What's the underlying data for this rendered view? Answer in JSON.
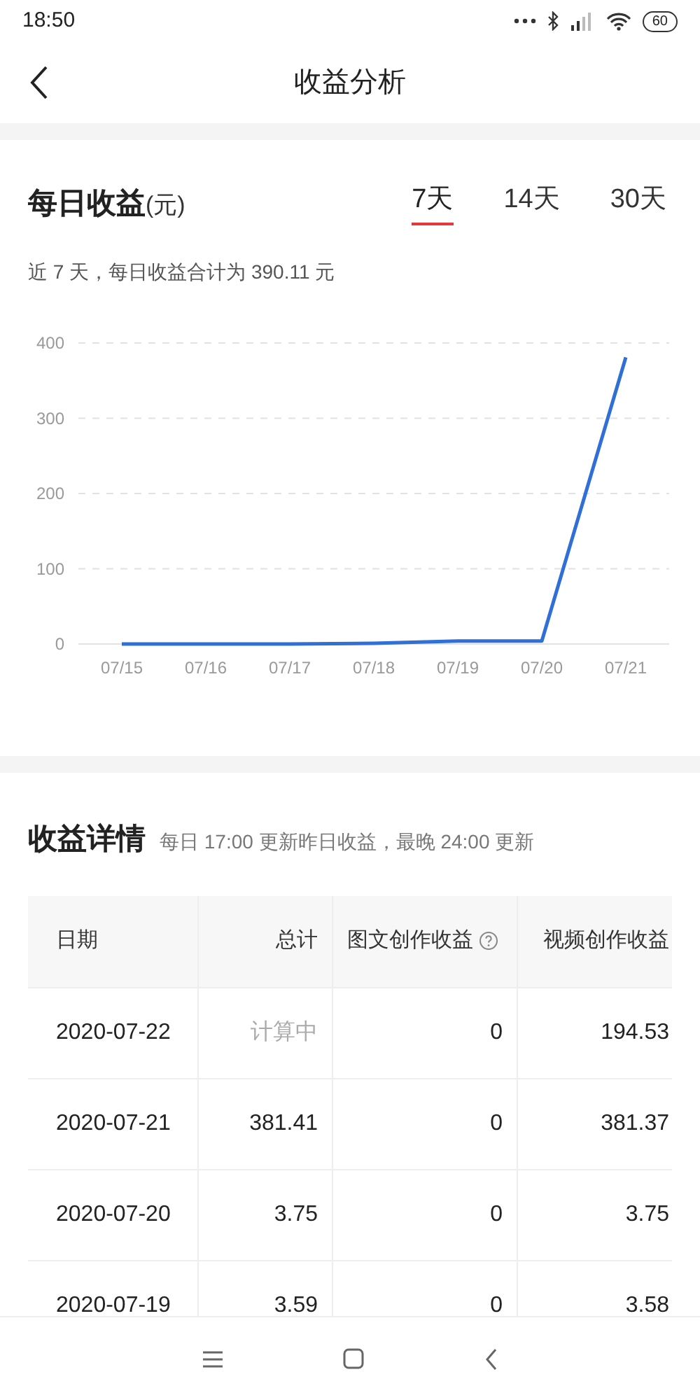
{
  "status_bar": {
    "time": "18:50",
    "battery": "60"
  },
  "header": {
    "title": "收益分析"
  },
  "daily": {
    "title": "每日收益",
    "unit": "(元)",
    "tabs": [
      {
        "label": "7天",
        "selected": true
      },
      {
        "label": "14天",
        "selected": false
      },
      {
        "label": "30天",
        "selected": false
      }
    ],
    "summary": "近 7 天，每日收益合计为 390.11 元",
    "chart_data": {
      "type": "line",
      "categories": [
        "07/15",
        "07/16",
        "07/17",
        "07/18",
        "07/19",
        "07/20",
        "07/21"
      ],
      "series": [
        {
          "color": "#2f6fd6",
          "values": [
            0,
            0,
            0,
            1,
            4,
            4,
            381
          ]
        }
      ],
      "ylim": [
        0,
        400
      ],
      "yticks": [
        0,
        100,
        200,
        300,
        400
      ],
      "grid": true
    }
  },
  "details": {
    "title": "收益详情",
    "note": "每日 17:00 更新昨日收益，最晚 24:00 更新",
    "columns": [
      {
        "label": "日期",
        "kind": "plain"
      },
      {
        "label": "总计",
        "kind": "plain"
      },
      {
        "label": "图文创作收益",
        "kind": "help"
      },
      {
        "label": "视频创作收益",
        "kind": "plain"
      }
    ],
    "rows": [
      {
        "cells": [
          "2020-07-22",
          "计算中",
          "0",
          "194.53"
        ],
        "total_pending": true
      },
      {
        "cells": [
          "2020-07-21",
          "381.41",
          "0",
          "381.37"
        ],
        "total_pending": false
      },
      {
        "cells": [
          "2020-07-20",
          "3.75",
          "0",
          "3.75"
        ],
        "total_pending": false
      },
      {
        "cells": [
          "2020-07-19",
          "3.59",
          "0",
          "3.58"
        ],
        "total_pending": false
      }
    ]
  }
}
